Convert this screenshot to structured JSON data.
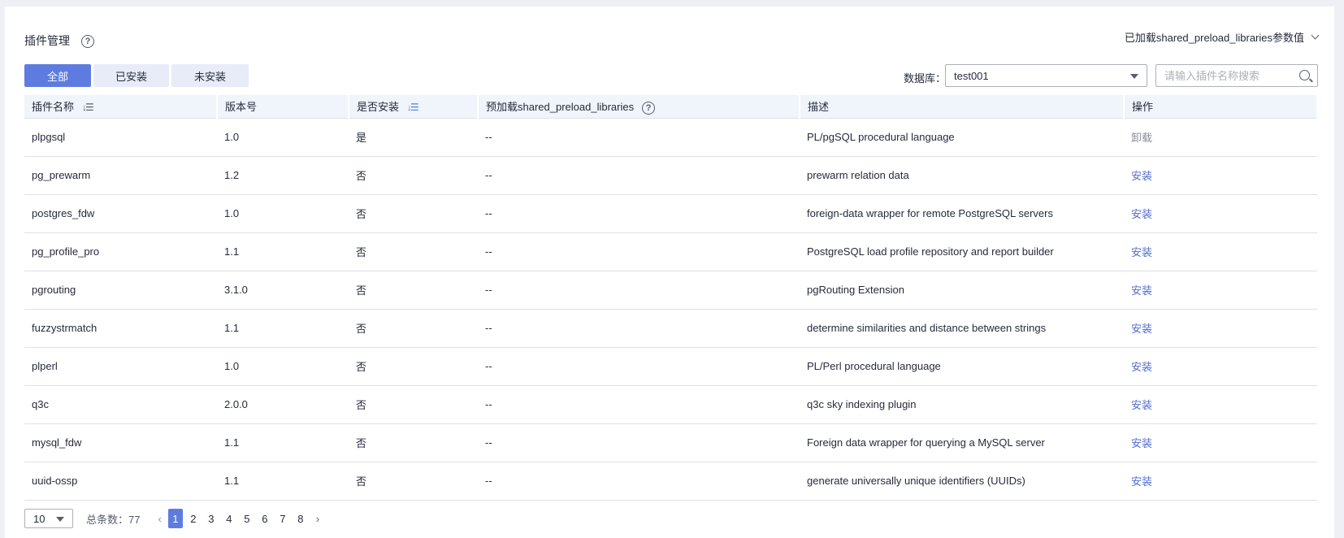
{
  "header": {
    "title": "插件管理",
    "preload_dropdown": "已加载shared_preload_libraries参数值"
  },
  "tabs": [
    "全部",
    "已安装",
    "未安装"
  ],
  "filter": {
    "db_label": "数据库：",
    "db_value": "test001",
    "search_placeholder": "请输入插件名称搜索"
  },
  "columns": [
    "插件名称",
    "版本号",
    "是否安装",
    "预加载shared_preload_libraries",
    "描述",
    "操作"
  ],
  "rows": [
    {
      "name": "plpgsql",
      "version": "1.0",
      "installed": "是",
      "preload": "--",
      "desc": "PL/pgSQL procedural language",
      "action": "卸载"
    },
    {
      "name": "pg_prewarm",
      "version": "1.2",
      "installed": "否",
      "preload": "--",
      "desc": "prewarm relation data",
      "action": "安装"
    },
    {
      "name": "postgres_fdw",
      "version": "1.0",
      "installed": "否",
      "preload": "--",
      "desc": "foreign-data wrapper for remote PostgreSQL servers",
      "action": "安装"
    },
    {
      "name": "pg_profile_pro",
      "version": "1.1",
      "installed": "否",
      "preload": "--",
      "desc": "PostgreSQL load profile repository and report builder",
      "action": "安装"
    },
    {
      "name": "pgrouting",
      "version": "3.1.0",
      "installed": "否",
      "preload": "--",
      "desc": "pgRouting Extension",
      "action": "安装"
    },
    {
      "name": "fuzzystrmatch",
      "version": "1.1",
      "installed": "否",
      "preload": "--",
      "desc": "determine similarities and distance between strings",
      "action": "安装"
    },
    {
      "name": "plperl",
      "version": "1.0",
      "installed": "否",
      "preload": "--",
      "desc": "PL/Perl procedural language",
      "action": "安装"
    },
    {
      "name": "q3c",
      "version": "2.0.0",
      "installed": "否",
      "preload": "--",
      "desc": "q3c sky indexing plugin",
      "action": "安装"
    },
    {
      "name": "mysql_fdw",
      "version": "1.1",
      "installed": "否",
      "preload": "--",
      "desc": "Foreign data wrapper for querying a MySQL server",
      "action": "安装"
    },
    {
      "name": "uuid-ossp",
      "version": "1.1",
      "installed": "否",
      "preload": "--",
      "desc": "generate universally unique identifiers (UUIDs)",
      "action": "安装"
    }
  ],
  "pagination": {
    "page_size": "10",
    "total_label": "总条数：77",
    "pages": [
      "1",
      "2",
      "3",
      "4",
      "5",
      "6",
      "7",
      "8"
    ],
    "current": "1"
  }
}
